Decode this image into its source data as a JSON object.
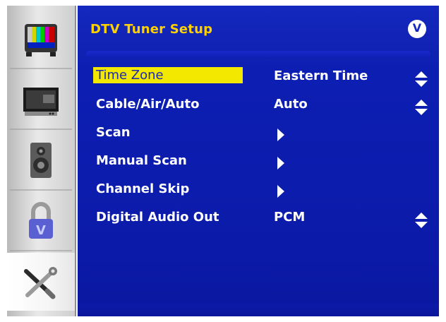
{
  "header": {
    "title": "DTV Tuner Setup",
    "logo_letter": "V"
  },
  "sidebar": {
    "items": [
      {
        "name": "picture-icon"
      },
      {
        "name": "tv-icon"
      },
      {
        "name": "speaker-icon"
      },
      {
        "name": "lock-icon"
      },
      {
        "name": "tools-icon",
        "active": true
      }
    ]
  },
  "menu": {
    "items": [
      {
        "label": "Time Zone",
        "value": "Eastern Time",
        "control": "updown",
        "selected": true
      },
      {
        "label": "Cable/Air/Auto",
        "value": "Auto",
        "control": "updown"
      },
      {
        "label": "Scan",
        "value": "",
        "control": "arrow"
      },
      {
        "label": "Manual Scan",
        "value": "",
        "control": "arrow"
      },
      {
        "label": "Channel Skip",
        "value": "",
        "control": "arrow"
      },
      {
        "label": "Digital Audio Out",
        "value": "PCM",
        "control": "updown"
      }
    ]
  },
  "colors": {
    "background": "#0d1fb3",
    "title": "#ffd100",
    "highlight": "#f3e800"
  }
}
